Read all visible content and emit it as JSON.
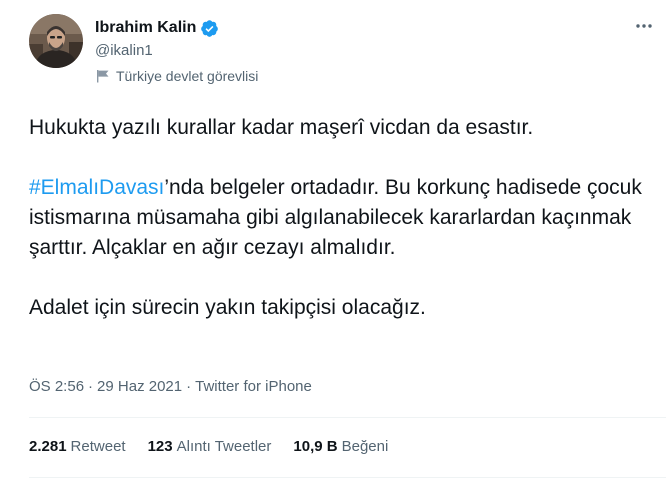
{
  "author": {
    "display_name": "Ibrahim Kalin",
    "handle": "@ikalin1",
    "label": "Türkiye devlet görevlisi",
    "verified": true
  },
  "tweet": {
    "para1": "Hukukta yazılı kurallar kadar maşerî vicdan da esastır.",
    "hashtag": "#ElmalıDavası",
    "para2_rest": "’nda belgeler ortadadır. Bu korkunç hadisede çocuk istismarına müsamaha gibi algılanabilecek kararlardan kaçınmak şarttır. Alçaklar en ağır cezayı almalıdır.",
    "para3": "Adalet için sürecin yakın takipçisi olacağız."
  },
  "meta": {
    "time": "ÖS 2:56",
    "separator": "·",
    "date": "29 Haz 2021",
    "source": "Twitter for iPhone"
  },
  "stats": {
    "retweets_count": "2.281",
    "retweets_label": "Retweet",
    "quotes_count": "123",
    "quotes_label": "Alıntı Tweetler",
    "likes_count": "10,9 B",
    "likes_label": "Beğeni"
  },
  "colors": {
    "accent": "#1d9bf0",
    "secondary_text": "#536471",
    "primary_text": "#0f1419",
    "divider": "#eff3f4"
  },
  "icons": {
    "verified": "verified-badge-icon",
    "label": "flag-icon",
    "more": "more-icon"
  }
}
